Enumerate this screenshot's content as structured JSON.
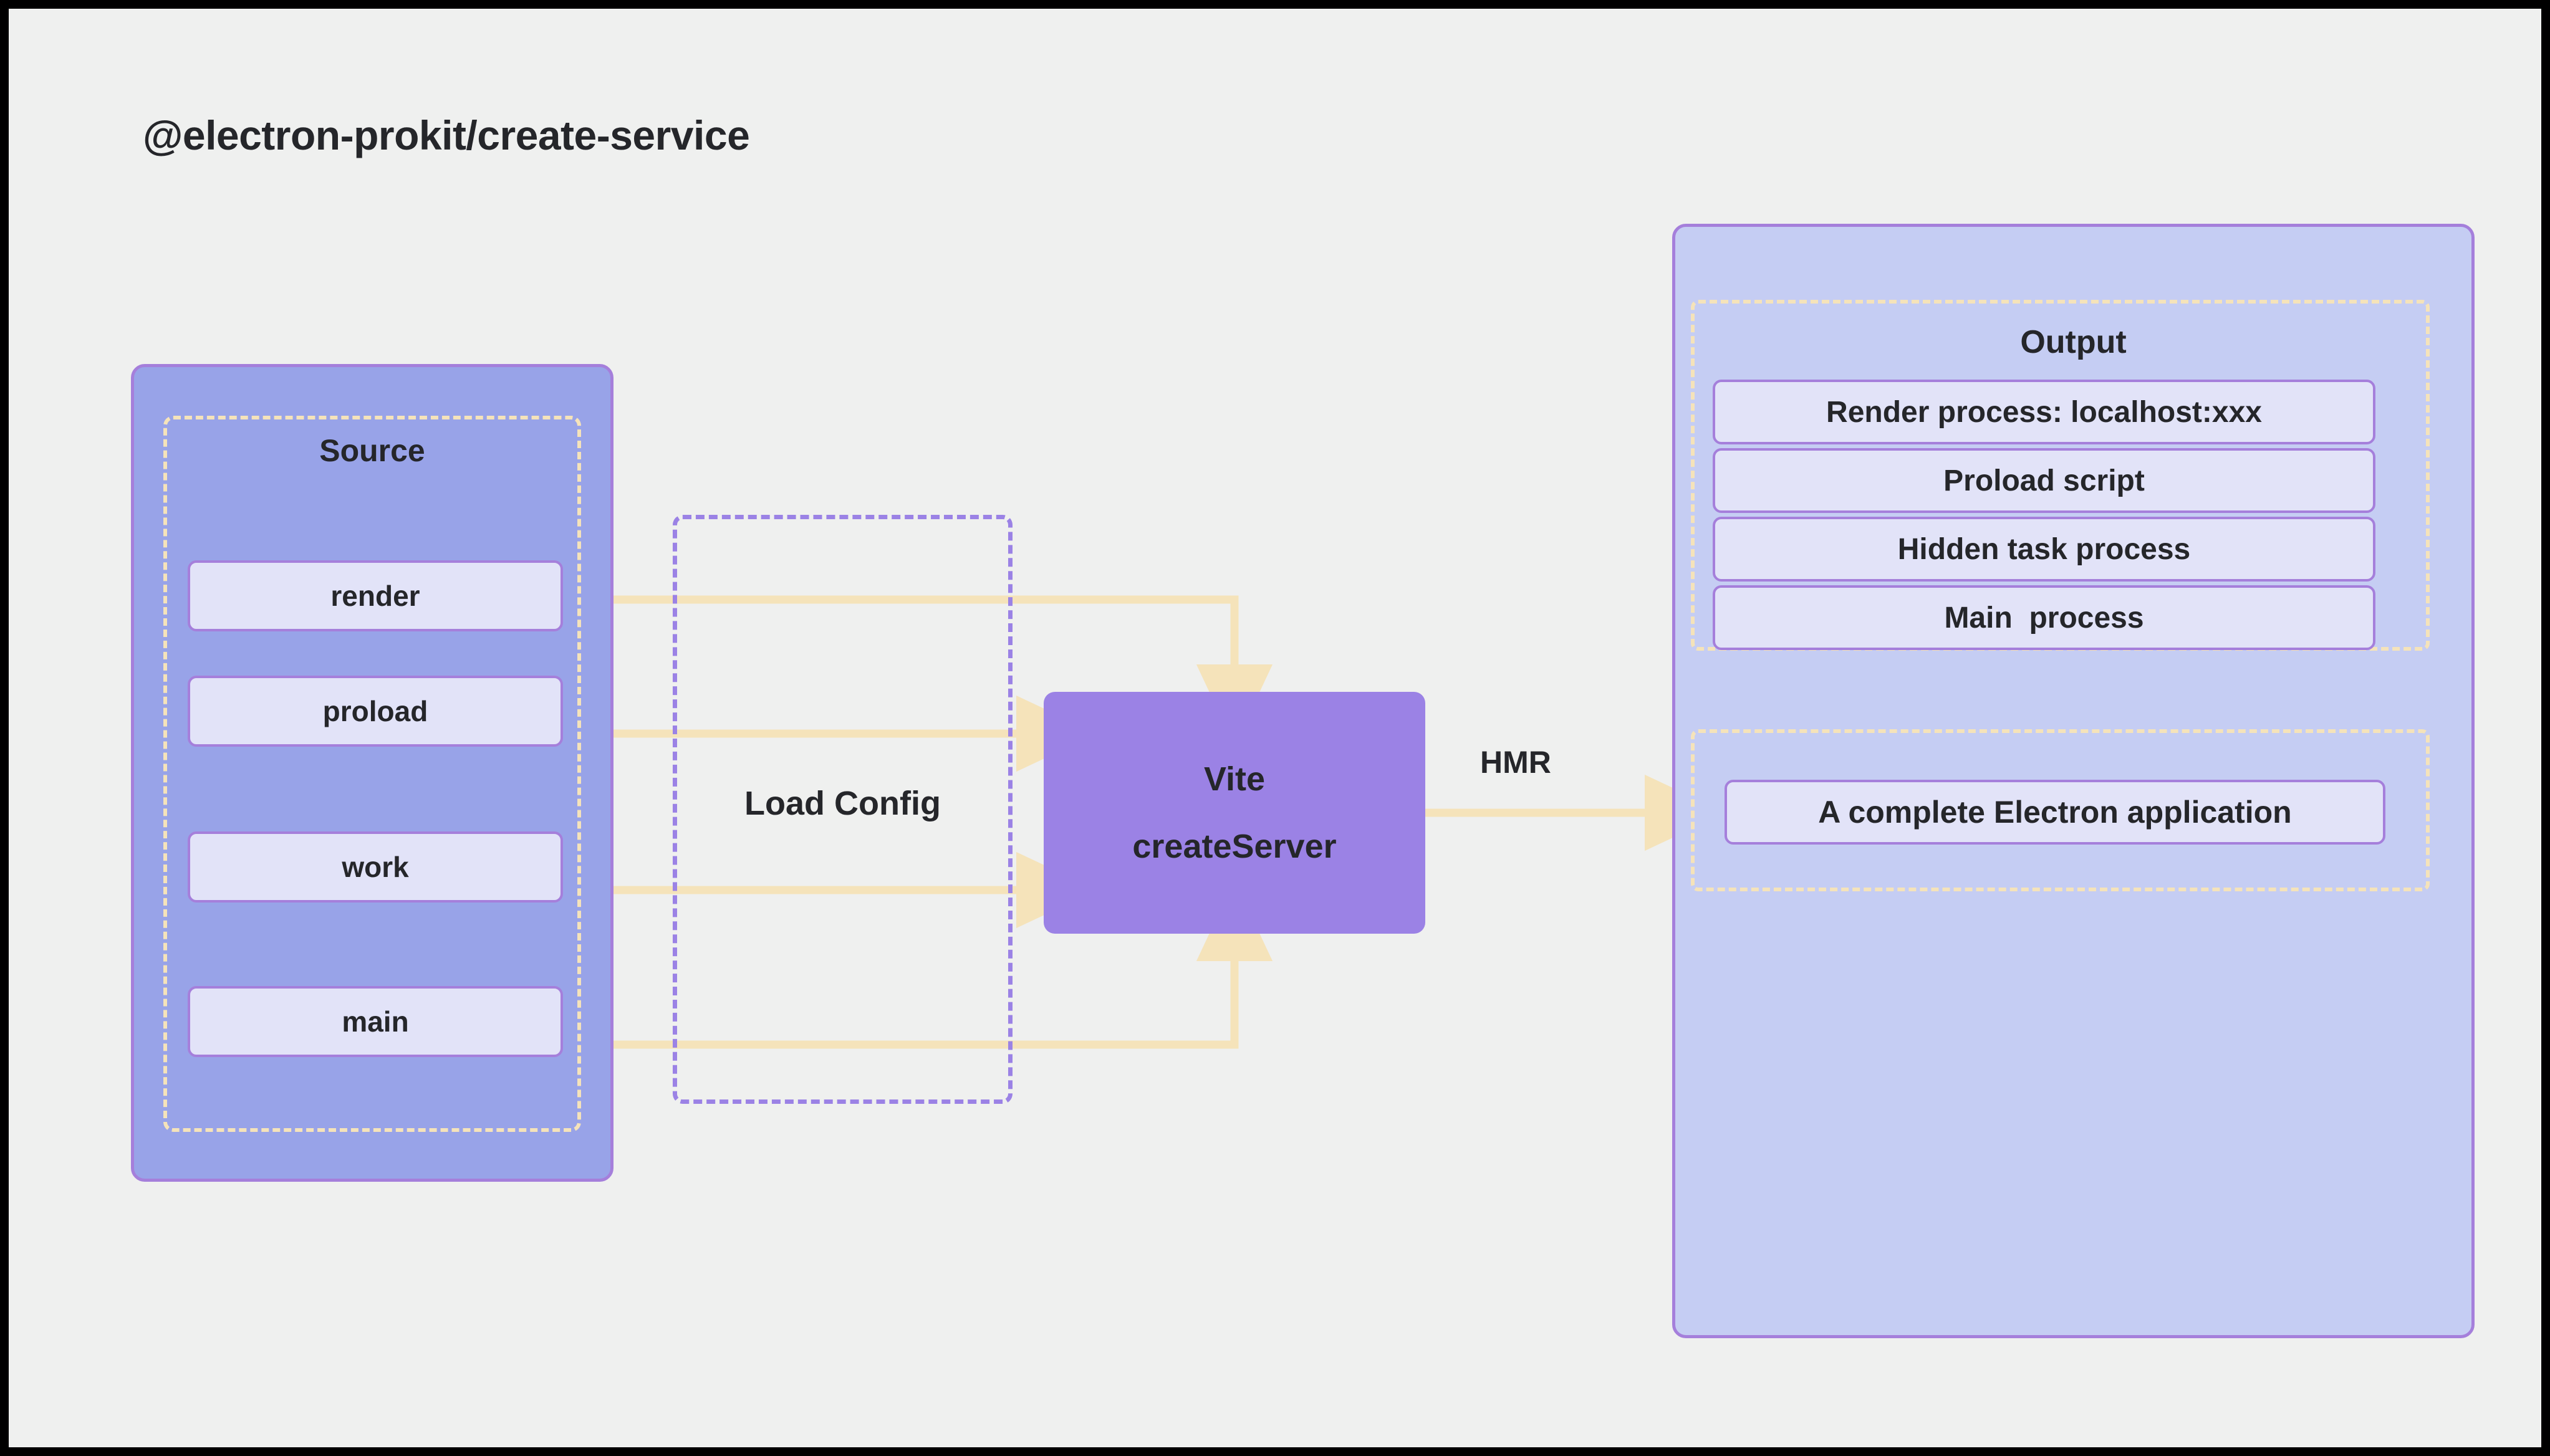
{
  "title": "@electron-prokit/create-service",
  "colors": {
    "canvas_bg": "#eff0ef",
    "page_border": "#000000",
    "source_panel_fill": "#98a3e8",
    "output_panel_fill": "#c5cdf3",
    "chip_fill": "#e2e3f8",
    "chip_border": "#a57fdb",
    "vite_fill": "#9b82e5",
    "dashed_cream": "#f5e3ba",
    "dashed_purple": "#9b82e5",
    "arrow": "#f5e3ba",
    "text": "#25262a"
  },
  "source": {
    "heading": "Source",
    "items": [
      {
        "label": "render"
      },
      {
        "label": "proload"
      },
      {
        "label": "work"
      },
      {
        "label": "main"
      }
    ]
  },
  "load_config": {
    "label": "Load Config"
  },
  "vite": {
    "line1": "Vite",
    "line2": "createServer"
  },
  "edge_labels": {
    "hmr": "HMR"
  },
  "output": {
    "heading": "Output",
    "items": [
      {
        "label": "Render process: localhost:xxx"
      },
      {
        "label": "Proload script"
      },
      {
        "label": "Hidden task process"
      },
      {
        "label": "Main  process"
      }
    ],
    "final": {
      "label": "A complete Electron application"
    }
  }
}
